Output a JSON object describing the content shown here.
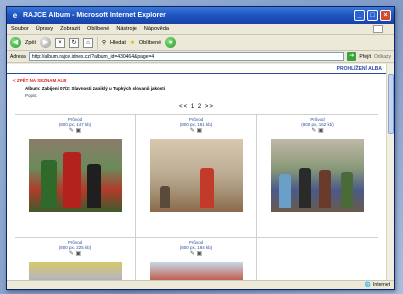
{
  "window": {
    "title": "RAJCE Album - Microsoft Internet Explorer",
    "minimize": "_",
    "maximize": "□",
    "close": "×"
  },
  "menu": [
    "Soubor",
    "Úpravy",
    "Zobrazit",
    "Oblíbené",
    "Nástroje",
    "Nápověda"
  ],
  "toolbar": {
    "back_label": "Zpět",
    "search_label": "Hledat",
    "favorites_label": "Oblíbené"
  },
  "address": {
    "label": "Adresa",
    "url": "http://album.rajce.idnes.cz/?album_id=430464&page=4",
    "go_label": "Přejít",
    "links_label": "Odkazy"
  },
  "page": {
    "header": "PROHLÍŽENÍ ALBA",
    "back_link": "< ZPĚT NA SEZNAM ALB",
    "album_title": "Album: Zabíjení 07/2: Slavnosti zaniklý u Tupkých slovanů jakosti",
    "album_sub": "Popis:",
    "pager": "<< 1 2 >>"
  },
  "photos_row1": [
    {
      "label": "Průvod",
      "meta": "(800 px, 147 kb)",
      "icons": "✎ ▣"
    },
    {
      "label": "Průvod",
      "meta": "(800 px, 181 kb)",
      "icons": "✎ ▣"
    },
    {
      "label": "Průvod",
      "meta": "(800 px, 162 kb)",
      "icons": "✎ ▣"
    }
  ],
  "photos_row2": [
    {
      "label": "Průvod",
      "meta": "(800 px, 225 kb)",
      "icons": "✎ ▣"
    },
    {
      "label": "Průvod",
      "meta": "(800 px, 194 kb)",
      "icons": "✎ ▣"
    }
  ],
  "status": {
    "zone": "Internet"
  }
}
